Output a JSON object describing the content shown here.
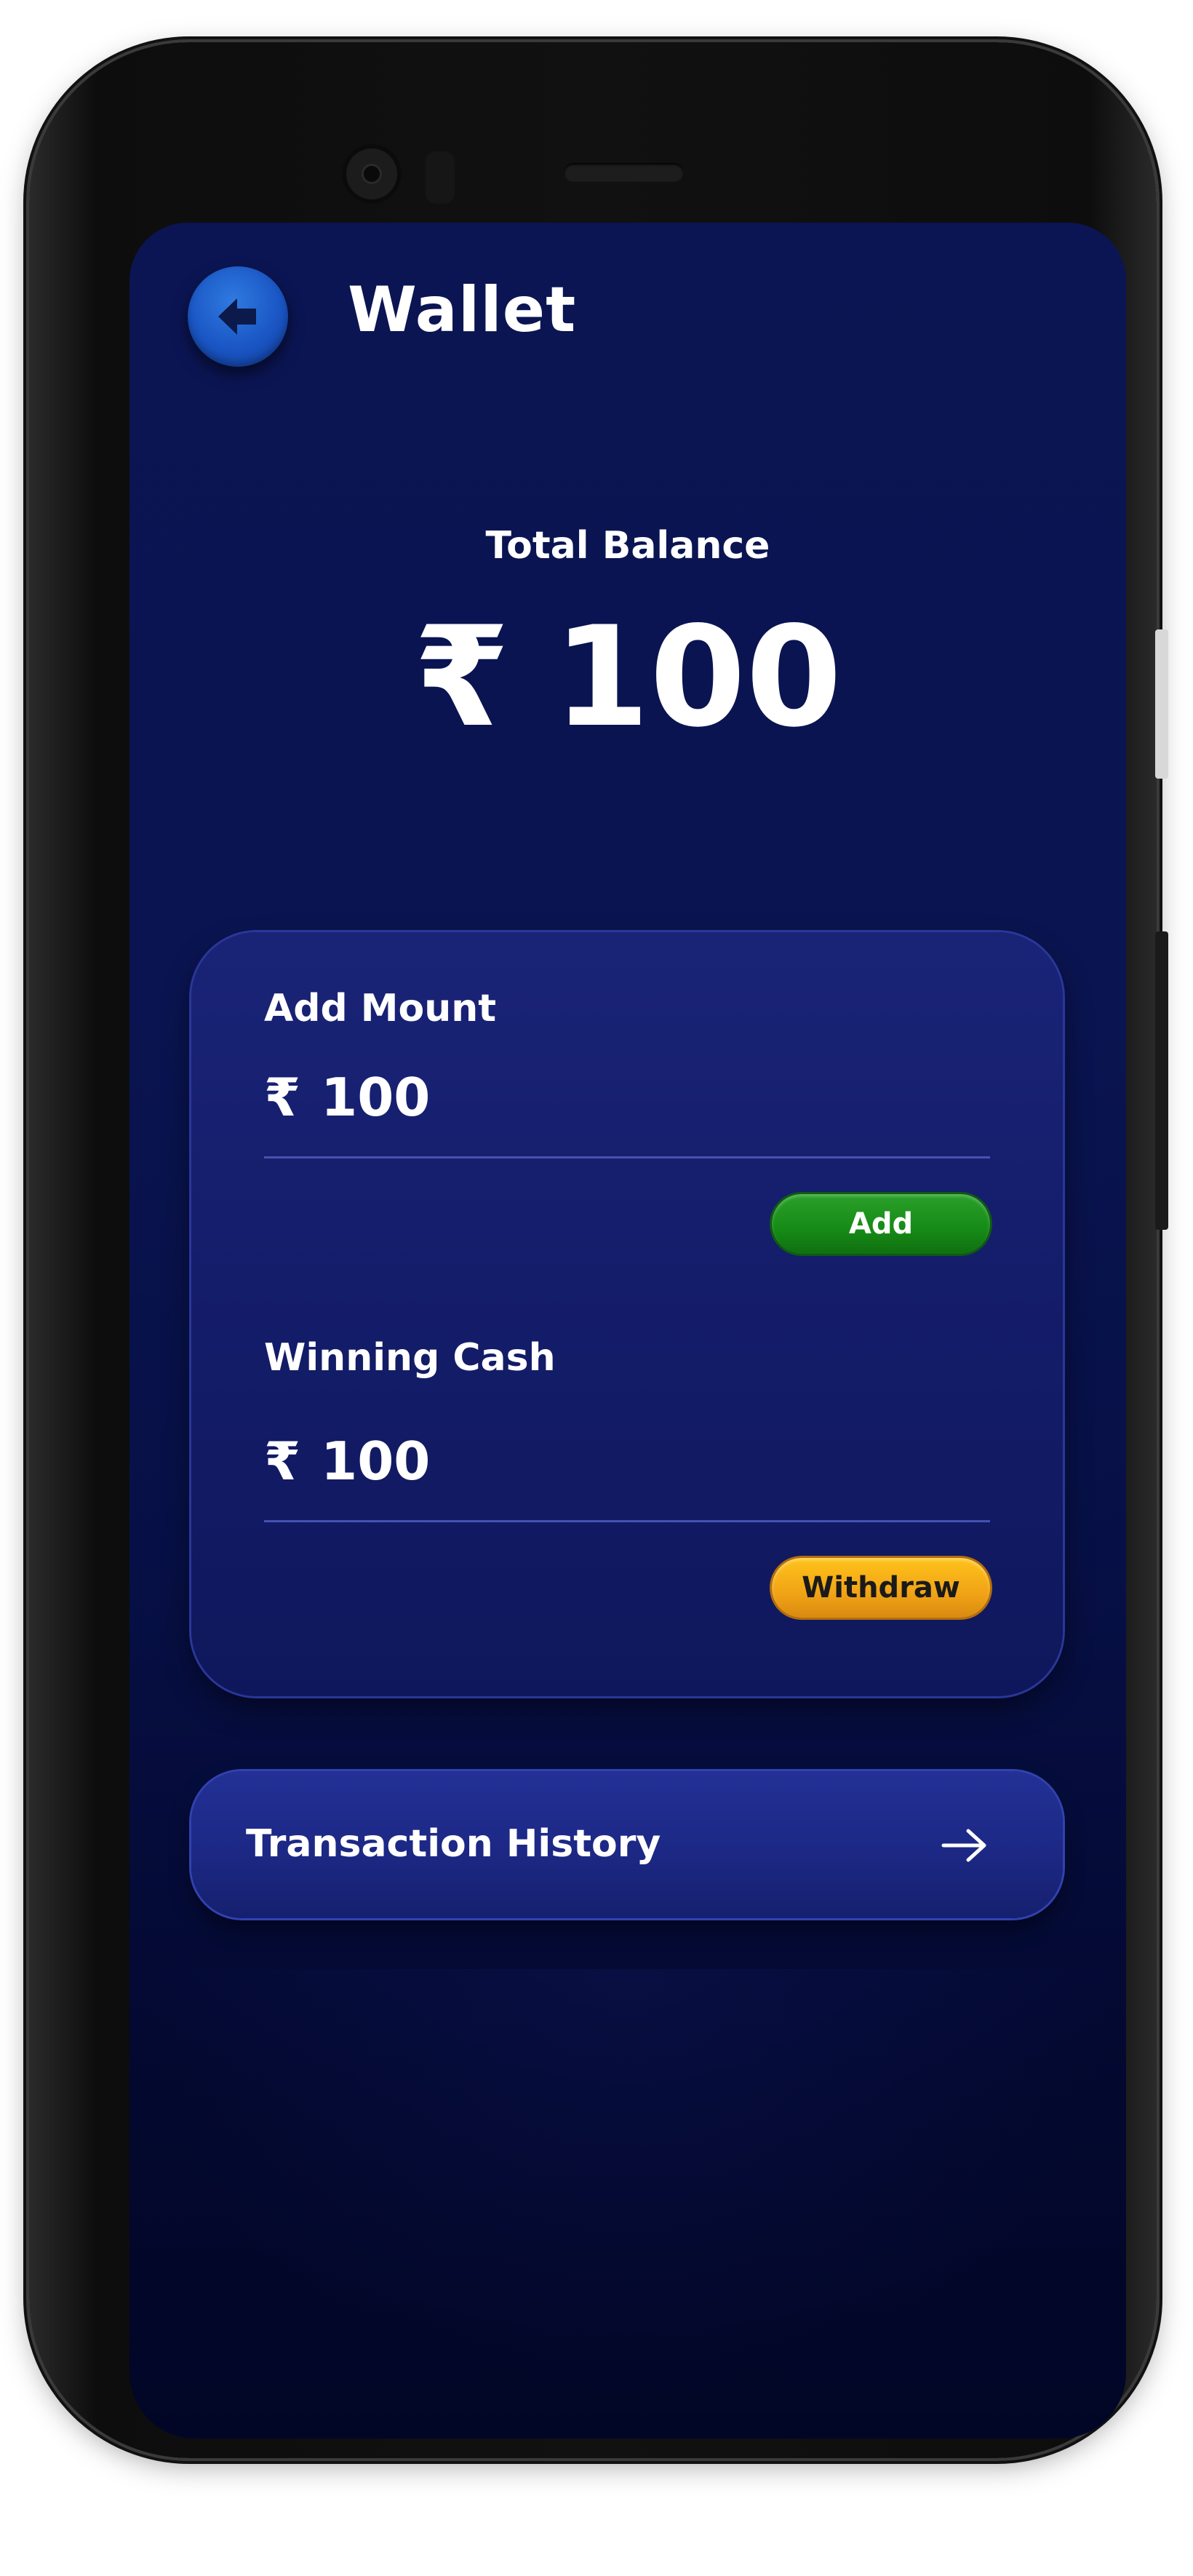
{
  "header": {
    "title": "Wallet",
    "back_icon": "arrow-left-icon"
  },
  "balance": {
    "label": "Total Balance",
    "currency": "₹",
    "amount": "100"
  },
  "add_section": {
    "label": "Add Mount",
    "currency": "₹",
    "value": "100",
    "button_label": "Add"
  },
  "winning_section": {
    "label": "Winning Cash",
    "currency": "₹",
    "value": "100",
    "button_label": "Withdraw"
  },
  "history": {
    "label": "Transaction History",
    "icon": "arrow-right-icon"
  },
  "colors": {
    "background": "#0a1450",
    "card": "#141d6a",
    "add_button": "#168a16",
    "withdraw_button": "#f0a316",
    "back_button": "#1a56c4"
  }
}
